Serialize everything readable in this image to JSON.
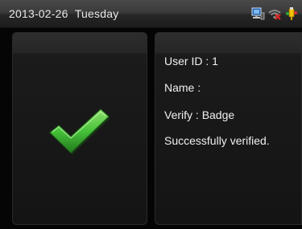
{
  "status_bar": {
    "date": "2013-02-26",
    "weekday": "Tuesday",
    "icons": [
      "network-icon",
      "wifi-disabled-icon",
      "usb-icon"
    ]
  },
  "result": {
    "icon": "checkmark-icon",
    "color": "#47c23a"
  },
  "info": {
    "user_id_label": "User ID :",
    "user_id_value": "1",
    "name_label": "Name :",
    "name_value": "",
    "verify_label": "Verify :",
    "verify_value": "Badge",
    "message": "Successfully verified."
  }
}
